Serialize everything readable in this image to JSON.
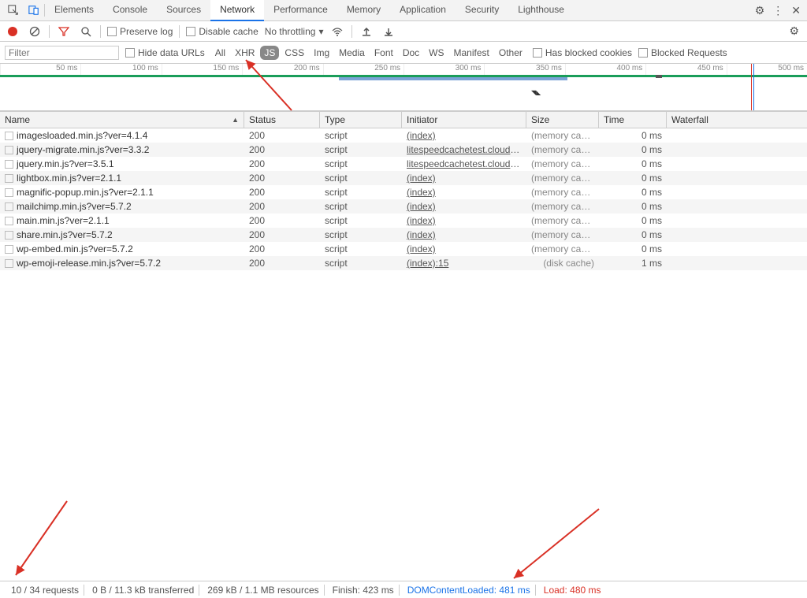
{
  "tabs": [
    "Elements",
    "Console",
    "Sources",
    "Network",
    "Performance",
    "Memory",
    "Application",
    "Security",
    "Lighthouse"
  ],
  "activeTab": 3,
  "toolbar": {
    "preserveLog": "Preserve log",
    "disableCache": "Disable cache",
    "throttling": "No throttling"
  },
  "filterBar": {
    "placeholder": "Filter",
    "hideDataUrls": "Hide data URLs",
    "chips": [
      "All",
      "XHR",
      "JS",
      "CSS",
      "Img",
      "Media",
      "Font",
      "Doc",
      "WS",
      "Manifest",
      "Other"
    ],
    "activeChip": 2,
    "hasBlockedCookies": "Has blocked cookies",
    "blockedRequests": "Blocked Requests"
  },
  "timelineTicks": [
    "50 ms",
    "100 ms",
    "150 ms",
    "200 ms",
    "250 ms",
    "300 ms",
    "350 ms",
    "400 ms",
    "450 ms",
    "500 ms"
  ],
  "columns": [
    "Name",
    "Status",
    "Type",
    "Initiator",
    "Size",
    "Time",
    "Waterfall"
  ],
  "rows": [
    {
      "name": "imagesloaded.min.js?ver=4.1.4",
      "status": "200",
      "type": "script",
      "initiator": "(index)",
      "size": "(memory cache)",
      "time": "0 ms",
      "wf": 82
    },
    {
      "name": "jquery-migrate.min.js?ver=3.3.2",
      "status": "200",
      "type": "script",
      "initiator": "litespeedcachetest.cloudpages...",
      "size": "(memory cache)",
      "time": "0 ms",
      "wf": 48
    },
    {
      "name": "jquery.min.js?ver=3.5.1",
      "status": "200",
      "type": "script",
      "initiator": "litespeedcachetest.cloudpages...",
      "size": "(memory cache)",
      "time": "0 ms",
      "wf": 48
    },
    {
      "name": "lightbox.min.js?ver=2.1.1",
      "status": "200",
      "type": "script",
      "initiator": "(index)",
      "size": "(memory cache)",
      "time": "0 ms",
      "wf": 86
    },
    {
      "name": "magnific-popup.min.js?ver=2.1.1",
      "status": "200",
      "type": "script",
      "initiator": "(index)",
      "size": "(memory cache)",
      "time": "0 ms",
      "wf": 86
    },
    {
      "name": "mailchimp.min.js?ver=5.7.2",
      "status": "200",
      "type": "script",
      "initiator": "(index)",
      "size": "(memory cache)",
      "time": "0 ms",
      "wf": 86
    },
    {
      "name": "main.min.js?ver=2.1.1",
      "status": "200",
      "type": "script",
      "initiator": "(index)",
      "size": "(memory cache)",
      "time": "0 ms",
      "wf": 86
    },
    {
      "name": "share.min.js?ver=5.7.2",
      "status": "200",
      "type": "script",
      "initiator": "(index)",
      "size": "(memory cache)",
      "time": "0 ms",
      "wf": 86
    },
    {
      "name": "wp-embed.min.js?ver=5.7.2",
      "status": "200",
      "type": "script",
      "initiator": "(index)",
      "size": "(memory cache)",
      "time": "0 ms",
      "wf": 86
    },
    {
      "name": "wp-emoji-release.min.js?ver=5.7.2",
      "status": "200",
      "type": "script",
      "initiator": "(index):15",
      "size": "(disk cache)",
      "time": "1 ms",
      "wf": 66
    }
  ],
  "statusBar": {
    "requests": "10 / 34 requests",
    "transferred": "0 B / 11.3 kB transferred",
    "resources": "269 kB / 1.1 MB resources",
    "finish": "Finish: 423 ms",
    "dcl": "DOMContentLoaded: 481 ms",
    "load": "Load: 480 ms"
  }
}
